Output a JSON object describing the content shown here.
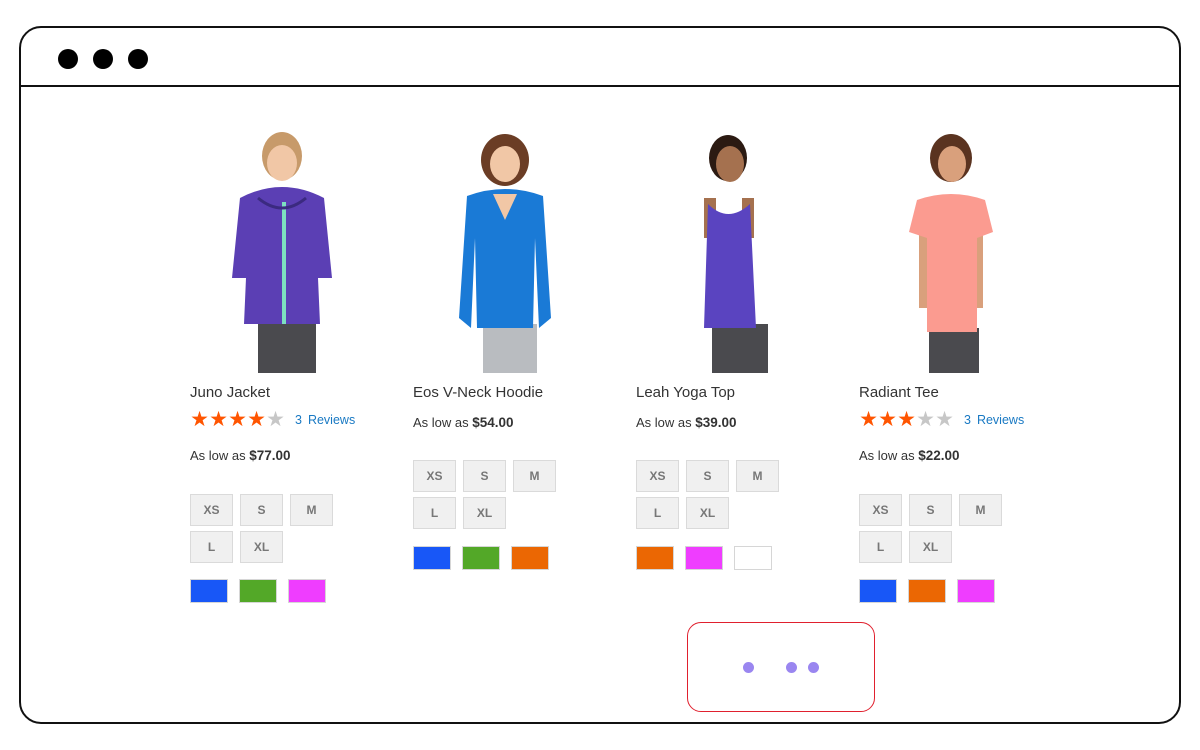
{
  "window": {
    "controls": [
      "close-dot",
      "minimize-dot",
      "maximize-dot"
    ]
  },
  "products": [
    {
      "name": "Juno Jacket",
      "rating": {
        "stars": 4,
        "max": 5,
        "count": "3",
        "label": "Reviews"
      },
      "price_prefix": "As low as",
      "price": "$77.00",
      "sizes": [
        "XS",
        "S",
        "M",
        "L",
        "XL"
      ],
      "swatches": [
        "#1857f7",
        "#53a828",
        "#ef3dff"
      ],
      "garment_color": "#5b3fb4"
    },
    {
      "name": "Eos V-Neck Hoodie",
      "rating": null,
      "price_prefix": "As low as",
      "price": "$54.00",
      "sizes": [
        "XS",
        "S",
        "M",
        "L",
        "XL"
      ],
      "swatches": [
        "#1857f7",
        "#53a828",
        "#eb6703"
      ],
      "garment_color": "#1a7ad6"
    },
    {
      "name": "Leah Yoga Top",
      "rating": null,
      "price_prefix": "As low as",
      "price": "$39.00",
      "sizes": [
        "XS",
        "S",
        "M",
        "L",
        "XL"
      ],
      "swatches": [
        "#eb6703",
        "#ef3dff",
        "#ffffff"
      ],
      "garment_color": "#5a44c0"
    },
    {
      "name": "Radiant Tee",
      "rating": {
        "stars": 3,
        "max": 5,
        "count": "3",
        "label": "Reviews"
      },
      "price_prefix": "As low as",
      "price": "$22.00",
      "sizes": [
        "XS",
        "S",
        "M",
        "L",
        "XL"
      ],
      "swatches": [
        "#1857f7",
        "#eb6703",
        "#ef3dff"
      ],
      "garment_color": "#fb9b90"
    }
  ],
  "loader": {
    "dot_color": "#9a86f0",
    "border_color": "#e0202e"
  }
}
